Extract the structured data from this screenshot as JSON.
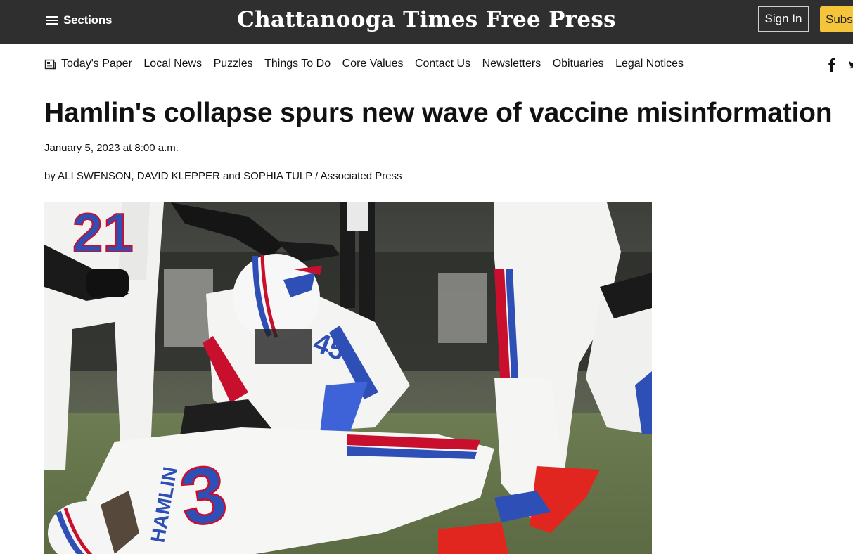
{
  "header": {
    "sections_label": "Sections",
    "logo_text": "Chattanooga Times Free Press",
    "signin_label": "Sign In",
    "subscribe_label": "Subs"
  },
  "nav": {
    "items": [
      {
        "label": "Today's Paper",
        "icon": "newspaper-icon"
      },
      {
        "label": "Local News"
      },
      {
        "label": "Puzzles"
      },
      {
        "label": "Things To Do"
      },
      {
        "label": "Core Values"
      },
      {
        "label": "Contact Us"
      },
      {
        "label": "Newsletters"
      },
      {
        "label": "Obituaries"
      },
      {
        "label": "Legal Notices"
      }
    ],
    "social": [
      "facebook-icon",
      "twitter-icon"
    ]
  },
  "article": {
    "headline": "Hamlin's collapse spurs new wave of vaccine misinformation",
    "date": "January 5, 2023 at 8:00 a.m.",
    "byline": "by ALI SWENSON, DAVID KLEPPER and SOPHIA TULP / Associated Press",
    "photo": {
      "jersey_name": "HAMLIN",
      "jersey_number": "3",
      "numbers_visible": [
        "21",
        "3"
      ]
    }
  },
  "colors": {
    "topbar": "#2f2f2f",
    "subscribe": "#f4c53b",
    "bills_blue": "#2e4fb5",
    "bills_red": "#c8102e"
  }
}
